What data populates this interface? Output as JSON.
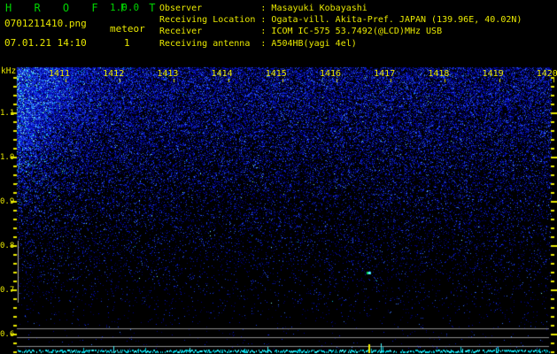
{
  "header": {
    "app_title": "H R O F F T",
    "app_version": "1.0.0",
    "filename": "0701211410.png",
    "mode": "meteor",
    "datetime": "07.01.21 14:10",
    "echo_count": "1",
    "separator": ":",
    "info_rows": [
      {
        "label": "Observer",
        "value": "Masayuki Kobayashi"
      },
      {
        "label": "Receiving Location",
        "value": "Ogata-vill. Akita-Pref. JAPAN (139.96E, 40.02N)"
      },
      {
        "label": "Receiver",
        "value": "ICOM IC-575 53.7492(@LCD)MHz USB"
      },
      {
        "label": "Receiving antenna",
        "value": "A504HB(yagi 4el)"
      }
    ]
  },
  "chart_data": {
    "type": "heatmap",
    "description": "HROFFT radio-meteor spectrogram: blue background noise, brightest at top-left, one meteor echo detected",
    "x_axis": {
      "unit": "time (hhmm)",
      "tick_labels": [
        "1411",
        "1412",
        "1413",
        "1414",
        "1415",
        "1416",
        "1417",
        "1418",
        "1419",
        "1420"
      ]
    },
    "y_axis": {
      "unit_label": "kHz",
      "tick_labels": [
        "1.1",
        "1.0",
        "0.9",
        "0.8",
        "0.7",
        "0.6"
      ],
      "tick_values": [
        1.1,
        1.0,
        0.9,
        0.8,
        0.7,
        0.6
      ],
      "minor_step_khz": 0.02
    },
    "echoes": [
      {
        "time_min": 1416.6,
        "freq_khz": 0.74
      }
    ],
    "count_spikes": [
      {
        "time_min": 1416.6,
        "count": 1
      }
    ],
    "level_trace": {
      "position": "bottom",
      "style": "dashed noise line"
    }
  },
  "colors": {
    "title_green": "#00d400",
    "text_yellow": "#e8e800",
    "grid_gray": "#8c8c8c",
    "scalebar_gray": "#aaaaaa",
    "trace_cyan": "#00ccdd",
    "trace_bright": "#40f8ff",
    "spike_yellow": "#f0f000",
    "echo_green": "#00d060",
    "echo_cyan": "#30d8f8",
    "echo_core": "#b0ffff"
  }
}
